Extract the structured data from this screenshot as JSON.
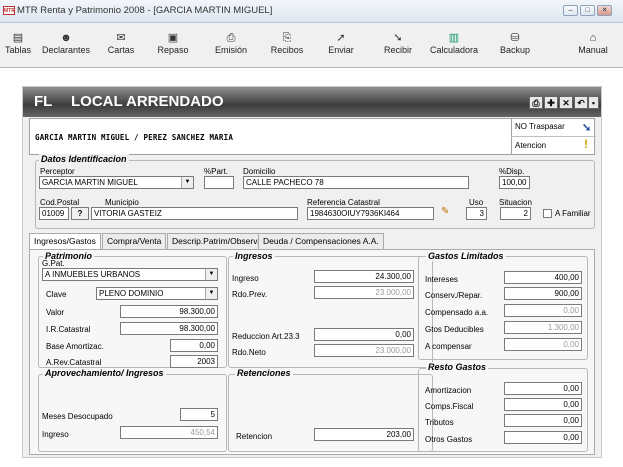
{
  "window": {
    "title": "MTR Renta y Patrimonio 2008 - [GARCIA MARTIN MIGUEL]",
    "app_icon": "mtr-app-icon",
    "controls": [
      "minimize",
      "maximize",
      "close"
    ],
    "child_controls": [
      "minimize",
      "restore",
      "close"
    ]
  },
  "toolbar": [
    {
      "label": "Tablas",
      "icon": "tables-icon"
    },
    {
      "label": "Declarantes",
      "icon": "declarants-icon"
    },
    {
      "label": "Cartas",
      "icon": "letters-icon"
    },
    {
      "label": "Repaso",
      "icon": "review-icon"
    },
    {
      "label": "Emisión",
      "icon": "printer-icon"
    },
    {
      "label": "Recibos",
      "icon": "receipts-icon"
    },
    {
      "label": "Enviar",
      "icon": "send-icon"
    },
    {
      "label": "Recibir",
      "icon": "receive-icon"
    },
    {
      "label": "Calculadora",
      "icon": "calculator-icon"
    },
    {
      "label": "Backup",
      "icon": "backup-icon"
    },
    {
      "label": "Manual",
      "icon": "manual-icon"
    }
  ],
  "form": {
    "code": "FL",
    "title": "LOCAL ARRENDADO",
    "names": "GARCIA MARTIN MIGUEL / PEREZ SANCHEZ MARIA",
    "traspasar": "NO Traspasar",
    "atencion": "Atencion",
    "datos_title": "Datos Identificacion",
    "perceptor_label": "Perceptor",
    "perceptor_value": "GARCIA MARTIN MIGUEL",
    "part_label": "%Part.",
    "part_value": "",
    "domicilio_label": "Domicilio",
    "domicilio_value": "CALLE PACHECO 78",
    "disp_label": "%Disp.",
    "disp_value": "100,00",
    "cp_label": "Cod.Postal",
    "cp_value": "01009",
    "cp_btn": "?",
    "municipio_label": "Municipio",
    "municipio_value": "VITORIA GASTEIZ",
    "refcat_label": "Referencia Catastral",
    "refcat_value": "1984630OIUY7936KI464",
    "uso_label": "Uso",
    "uso_value": "3",
    "situacion_label": "Situacion",
    "situacion_value": "2",
    "afamiliar_label": "A Familiar"
  },
  "tabs": [
    {
      "label": "Ingresos/Gastos",
      "active": true
    },
    {
      "label": "Compra/Venta",
      "active": false
    },
    {
      "label": "Descrip.Patrim/Observ.",
      "active": false
    },
    {
      "label": "Deuda / Compensaciones A.A.",
      "active": false
    }
  ],
  "patrimonio": {
    "title": "Patrimonio",
    "gpat_label": "G.Pat.",
    "gpat_value": "A  INMUEBLES URBANOS",
    "clave_label": "Clave",
    "clave_value": "PLENO DOMINIO",
    "valor_label": "Valor",
    "valor_value": "98.300,00",
    "ircat_label": "I.R.Catastral",
    "ircat_value": "98.300,00",
    "base_label": "Base Amortizac.",
    "base_value": "0,00",
    "arev_label": "A.Rev.Catastral",
    "arev_value": "2003"
  },
  "ingresos": {
    "title": "Ingresos",
    "ingreso_label": "Ingreso",
    "ingreso_value": "24.300,00",
    "rdoprev_label": "Rdo.Prev.",
    "rdoprev_value": "23.000,00",
    "reduccion_label": "Reduccion Art.23.3",
    "reduccion_value": "0,00",
    "rdoneto_label": "Rdo.Neto",
    "rdoneto_value": "23.000,00"
  },
  "gastos_limitados": {
    "title": "Gastos Limitados",
    "intereses_label": "Intereses",
    "intereses_value": "400,00",
    "conserv_label": "Conserv./Repar.",
    "conserv_value": "900,00",
    "compensado_label": "Compensado a.a.",
    "compensado_value": "0,00",
    "gtos_label": "Gtos Deducibles",
    "gtos_value": "1.300,00",
    "acomp_label": "A compensar",
    "acomp_value": "0,00"
  },
  "aprovechamiento": {
    "title": "Aprovechamiento/ Ingresos",
    "meses_label": "Meses Desocupado",
    "meses_value": "5",
    "ingreso_label": "Ingreso",
    "ingreso_value": "450,54"
  },
  "retenciones": {
    "title": "Retenciones",
    "retencion_label": "Retencion",
    "retencion_value": "203,00"
  },
  "resto_gastos": {
    "title": "Resto Gastos",
    "amort_label": "Amortizacion",
    "amort_value": "0,00",
    "comps_label": "Comps.Fiscal",
    "comps_value": "0,00",
    "trib_label": "Tributos",
    "trib_value": "0,00",
    "otros_label": "Otros Gastos",
    "otros_value": "0,00"
  }
}
